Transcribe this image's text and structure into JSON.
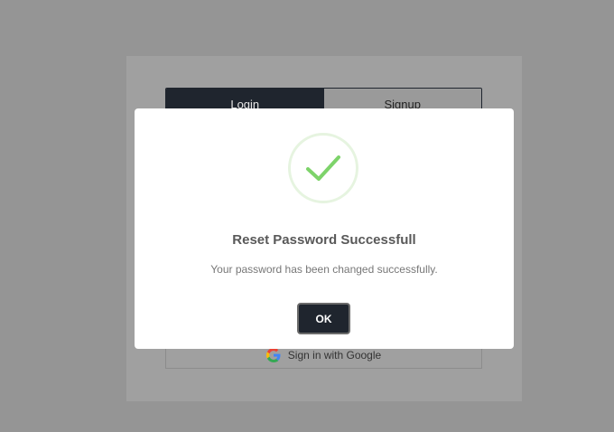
{
  "auth": {
    "tabs": [
      {
        "label": "Login",
        "active": true
      },
      {
        "label": "Signup",
        "active": false
      }
    ],
    "google_label": "Sign in with Google"
  },
  "modal": {
    "icon": "checkmark-icon",
    "title": "Reset Password Successfull",
    "message": "Your password has been changed successfully.",
    "ok_label": "OK"
  },
  "colors": {
    "backdrop": "#959595",
    "dark": "#1f252e",
    "success": "#7dd36a"
  }
}
